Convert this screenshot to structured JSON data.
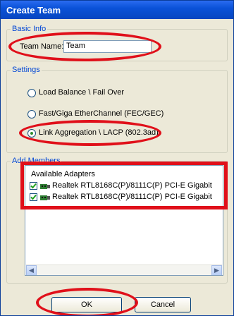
{
  "window": {
    "title": "Create Team"
  },
  "basic_info": {
    "legend": "Basic Info",
    "team_name_label": "Team Name:",
    "team_name_value": "Team"
  },
  "settings": {
    "legend": "Settings",
    "options": [
      {
        "label": "Load Balance \\ Fail Over",
        "selected": false
      },
      {
        "label": "Fast/Giga EtherChannel (FEC/GEC)",
        "selected": false
      },
      {
        "label": "Link Aggregation \\ LACP (802.3ad)",
        "selected": true
      }
    ]
  },
  "add_members": {
    "legend": "Add Members",
    "list_header": "Available Adapters",
    "adapters": [
      {
        "label": "Realtek RTL8168C(P)/8111C(P) PCI-E Gigabit",
        "checked": true
      },
      {
        "label": "Realtek RTL8168C(P)/8111C(P) PCI-E Gigabit",
        "checked": true
      }
    ]
  },
  "buttons": {
    "ok": "OK",
    "cancel": "Cancel"
  },
  "annotation_color": "#e0101a"
}
